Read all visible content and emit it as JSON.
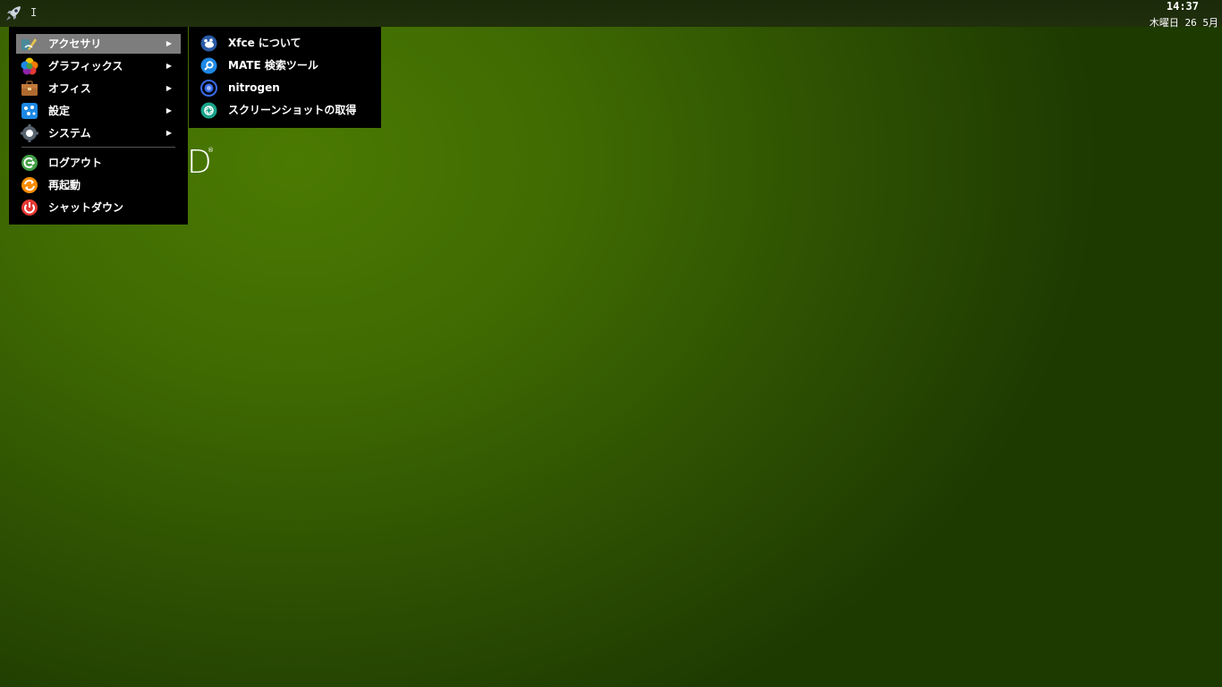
{
  "panel": {
    "cursor_glyph": "I",
    "clock": {
      "time": "14:37",
      "date": "木曜日 26 5月"
    }
  },
  "desktop": {
    "logo_text": "D",
    "logo_mark": "®"
  },
  "main_menu": {
    "items": [
      {
        "label": "アクセサリ",
        "icon": "accessories-icon",
        "has_submenu": true,
        "highlighted": true
      },
      {
        "label": "グラフィックス",
        "icon": "graphics-icon",
        "has_submenu": true
      },
      {
        "label": "オフィス",
        "icon": "office-icon",
        "has_submenu": true
      },
      {
        "label": "設定",
        "icon": "settings-icon",
        "has_submenu": true
      },
      {
        "label": "システム",
        "icon": "system-icon",
        "has_submenu": true
      }
    ],
    "session_items": [
      {
        "label": "ログアウト",
        "icon": "logout-icon"
      },
      {
        "label": "再起動",
        "icon": "restart-icon"
      },
      {
        "label": "シャットダウン",
        "icon": "shutdown-icon"
      }
    ],
    "arrow_glyph": "▶"
  },
  "sub_menu": {
    "items": [
      {
        "label": "Xfce について",
        "icon": "xfce-mouse-icon"
      },
      {
        "label": "MATE 検索ツール",
        "icon": "search-tool-icon"
      },
      {
        "label": "nitrogen",
        "icon": "nitrogen-icon"
      },
      {
        "label": "スクリーンショットの取得",
        "icon": "screenshot-icon"
      }
    ]
  },
  "colors": {
    "menu_bg": "#000000",
    "highlight": "#7d7d7d",
    "panel_bg": "#1a2a0a",
    "desktop_green": "#4b7a02"
  }
}
